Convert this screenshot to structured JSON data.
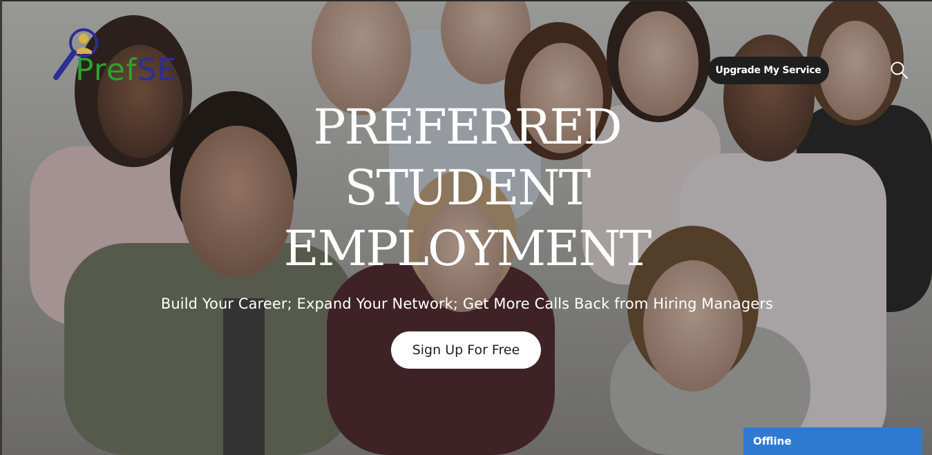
{
  "logo": {
    "text_part1": "Pref",
    "text_part2": "SE",
    "icon": "magnifier-person-icon"
  },
  "header": {
    "upgrade_label": "Upgrade My Service",
    "search_icon": "search-icon"
  },
  "hero": {
    "title_line1": "PREFERRED",
    "title_line2": "STUDENT",
    "title_line3": "EMPLOYMENT",
    "subtitle": "Build Your Career; Expand Your Network; Get More Calls Back from Hiring Managers",
    "cta_label": "Sign Up For Free"
  },
  "chat": {
    "status": "Offline"
  },
  "colors": {
    "logo_green": "#2fa12f",
    "logo_blue": "#2b2f93",
    "upgrade_bg": "#1f1f1f",
    "chat_blue": "#2f7ad1"
  }
}
